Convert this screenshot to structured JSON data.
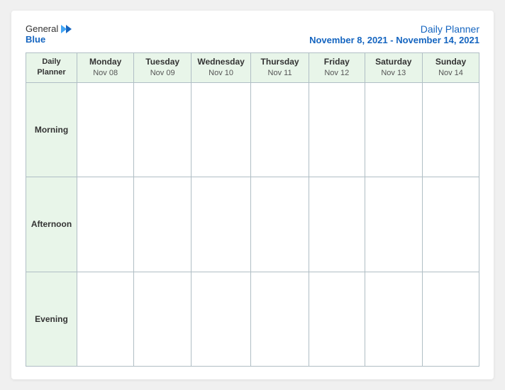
{
  "logo": {
    "general": "General",
    "blue": "Blue",
    "icon": "▶"
  },
  "title": {
    "main": "Daily Planner",
    "date_range": "November 8, 2021 - November 14, 2021"
  },
  "table": {
    "header_first_line": "Daily",
    "header_second_line": "Planner",
    "columns": [
      {
        "day": "Monday",
        "date": "Nov 08"
      },
      {
        "day": "Tuesday",
        "date": "Nov 09"
      },
      {
        "day": "Wednesday",
        "date": "Nov 10"
      },
      {
        "day": "Thursday",
        "date": "Nov 11"
      },
      {
        "day": "Friday",
        "date": "Nov 12"
      },
      {
        "day": "Saturday",
        "date": "Nov 13"
      },
      {
        "day": "Sunday",
        "date": "Nov 14"
      }
    ],
    "rows": [
      {
        "label": "Morning"
      },
      {
        "label": "Afternoon"
      },
      {
        "label": "Evening"
      }
    ]
  }
}
